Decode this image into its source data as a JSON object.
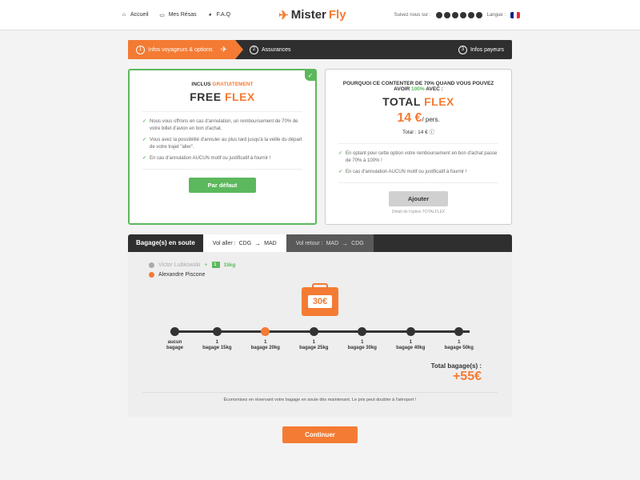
{
  "header": {
    "nav": {
      "home": "Accueil",
      "resas": "Mes Résas",
      "faq": "F.A.Q"
    },
    "logo": {
      "mister": "Mister",
      "fly": "Fly"
    },
    "follow": "Suivez nous sur :",
    "langue": "Langue :"
  },
  "steps": {
    "s1": "Infos voyageurs & options",
    "s2": "Assurances",
    "s3": "Infos payeurs"
  },
  "free": {
    "subtitle_pre": "INCLUS ",
    "subtitle_highlight": "GRATUITEMENT",
    "title_a": "FREE ",
    "title_b": "FLEX",
    "f1": "Nous vous offrons en cas d'annulation, un remboursement de 70% de votre billet d'avion en bon d'achat.",
    "f2": "Vous avez la possibilité d'annuler au plus tard jusqu'à la veille du départ de votre trajet \"aller\".",
    "f3": "En cas d'annulation AUCUN motif ou justificatif à fournir !",
    "btn": "Par défaut"
  },
  "total": {
    "subtitle_a": "POURQUOI CE CONTENTER DE 70% QUAND VOUS POUVEZ AVOIR ",
    "subtitle_b": "100%",
    "subtitle_c": " AVEC :",
    "title_a": "TOTAL ",
    "title_b": "FLEX",
    "price": "14 €",
    "per": "/ pers.",
    "total_line": "Total : 14 € ⓘ",
    "f1": "En optant pour cette option votre remboursement en bon d'achat passe de 70% à 100% !",
    "f2": "En cas d'annulation AUCUN motif ou justificatif à fournir !",
    "btn": "Ajouter",
    "note": "Détail de l'option TOTALFLEX"
  },
  "baggage": {
    "title": "Bagage(s) en soute",
    "tab1": {
      "label": "Vol aller :",
      "from": "CDG",
      "to": "MAD"
    },
    "tab2": {
      "label": "Vol retour :",
      "from": "MAD",
      "to": "CDG"
    },
    "p1": "Victor Lubkowski",
    "p1_weight": "15kg",
    "p2": "Alexandre Piscone",
    "suitcase_price": "30€",
    "options": [
      "aucun bagage",
      "1 bagage 15kg",
      "1 bagage 20kg",
      "1 bagage 25kg",
      "1 bagage 30kg",
      "1 bagage 40kg",
      "1 bagage 50kg"
    ],
    "selected_index": 2,
    "total_label": "Total bagage(s) :",
    "total_price": "+55€",
    "note": "Économisez en réservant votre bagage en soute dès maintenant. Le prix peut doubler à l'aéroport !"
  },
  "continue": "Continuer"
}
